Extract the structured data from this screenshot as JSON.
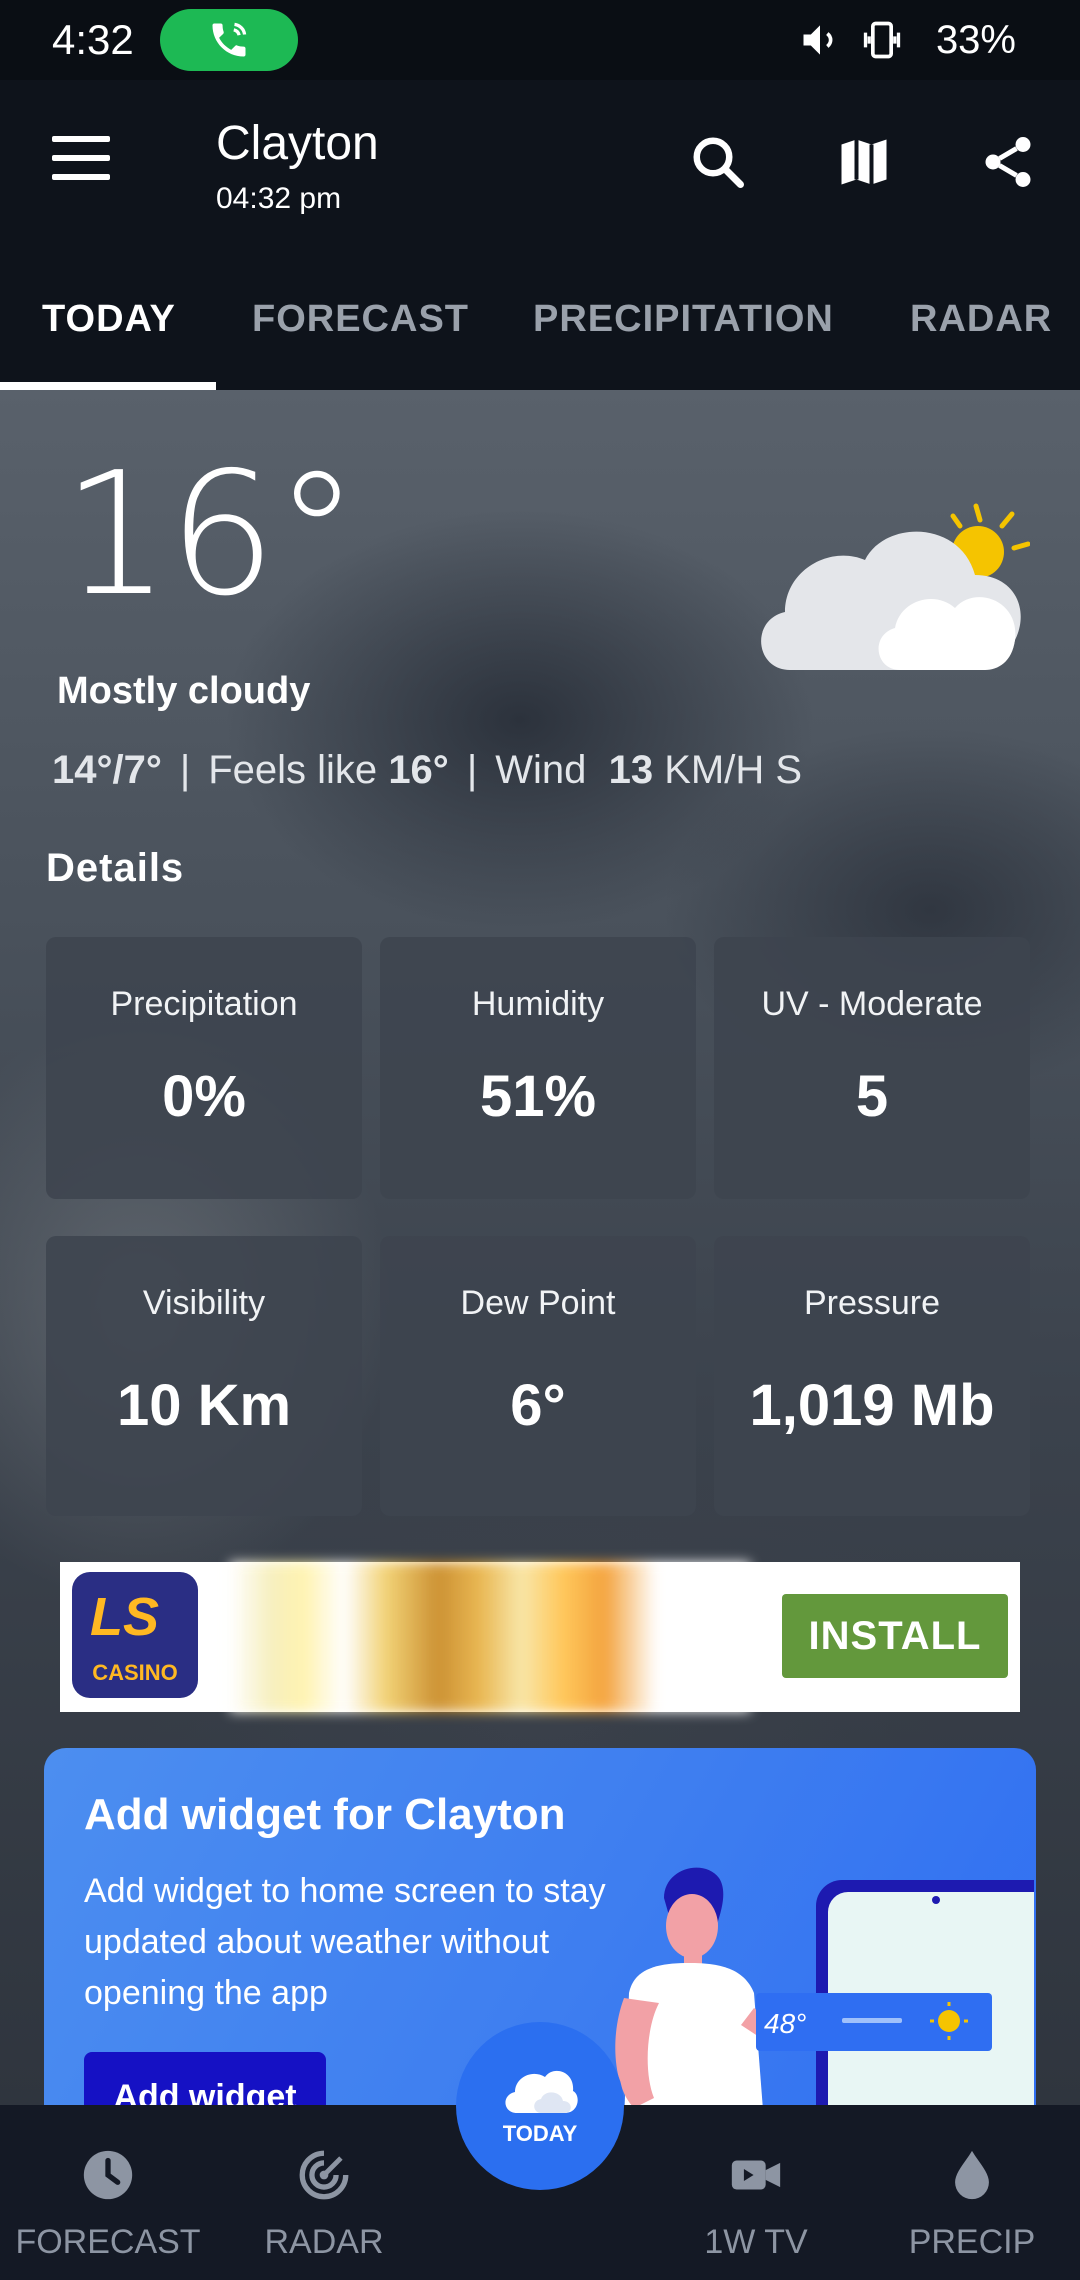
{
  "status_bar": {
    "time": "4:32",
    "battery": "33%",
    "call_icon": "phone-call-icon",
    "icons": [
      "volume-icon",
      "vibrate-icon"
    ]
  },
  "app_bar": {
    "city": "Clayton",
    "local_time": "04:32 pm",
    "icons": [
      "menu-icon",
      "search-icon",
      "map-icon",
      "share-icon"
    ]
  },
  "tabs": [
    {
      "label": "TODAY",
      "active": true
    },
    {
      "label": "FORECAST",
      "active": false
    },
    {
      "label": "PRECIPITATION",
      "active": false
    },
    {
      "label": "RADAR",
      "active": false
    }
  ],
  "current": {
    "temperature": "16°",
    "condition": "Mostly cloudy",
    "hi_lo": "14°/7°",
    "feels_like_label": "Feels like",
    "feels_like_value": "16°",
    "wind_label": "Wind",
    "wind_value": "13",
    "wind_unit": "KM/H S",
    "icon": "partly-cloudy-icon"
  },
  "details": {
    "title": "Details",
    "cards": [
      {
        "label": "Precipitation",
        "value": "0%"
      },
      {
        "label": "Humidity",
        "value": "51%"
      },
      {
        "label": "UV - Moderate",
        "value": "5"
      },
      {
        "label": "Visibility",
        "value": "10 Km"
      },
      {
        "label": "Dew Point",
        "value": "6°"
      },
      {
        "label": "Pressure",
        "value": "1,019 Mb"
      }
    ]
  },
  "ad": {
    "logo_text": "LS",
    "logo_subtext": "CASINO",
    "install_label": "INSTALL"
  },
  "promo": {
    "title": "Add widget for Clayton",
    "text": "Add widget to home screen to stay updated about weather without opening the app",
    "button_label": "Add widget",
    "widget_temp": "48°"
  },
  "bottom_nav": {
    "items": [
      {
        "label": "FORECAST",
        "icon": "clock-icon"
      },
      {
        "label": "RADAR",
        "icon": "radar-icon"
      },
      {
        "label": "1W TV",
        "icon": "video-icon"
      },
      {
        "label": "PRECIP",
        "icon": "drop-icon"
      }
    ],
    "fab_label": "TODAY",
    "fab_icon": "cloud-icon"
  },
  "colors": {
    "accent_blue": "#2b6ff0",
    "call_green": "#1db954",
    "install_green": "#63983c",
    "sun_yellow": "#f5c400"
  }
}
